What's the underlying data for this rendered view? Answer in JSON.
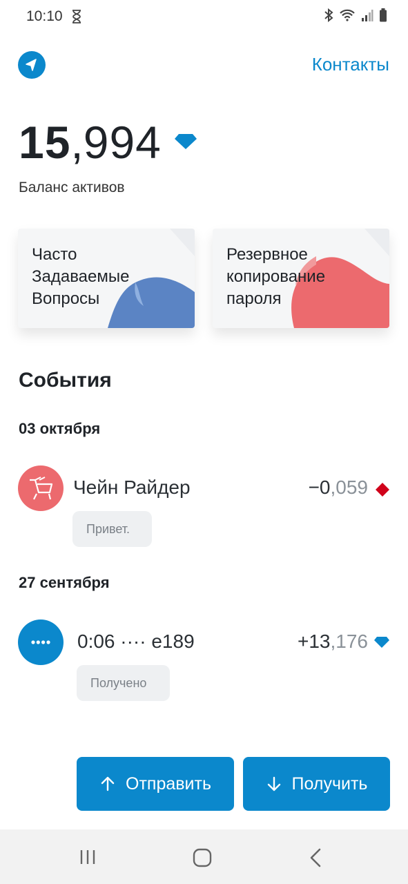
{
  "status_bar": {
    "time": "10:10",
    "icons": [
      "hourglass-icon",
      "bluetooth-icon",
      "wifi-icon",
      "signal-icon",
      "battery-icon"
    ]
  },
  "header": {
    "back_icon": "back-arrow-icon",
    "contacts_label": "Контакты"
  },
  "balance": {
    "integer_part": "15",
    "separator": ",",
    "fraction_part": "994",
    "label": "Баланс активов",
    "currency_icon": "diamond-icon"
  },
  "cards": [
    {
      "title": "Часто\nЗадаваемые\nВопросы",
      "color": "#5b84c4"
    },
    {
      "title": "Резервное\nкопирование\nпароля",
      "color": "#ec6a6e"
    }
  ],
  "events": {
    "title": "События",
    "groups": [
      {
        "date": "03 октября",
        "transactions": [
          {
            "name": "Чейн Райдер",
            "amount_main": "−0",
            "amount_sep": ",",
            "amount_frac": "059",
            "icon": "red-diamond-icon",
            "note": "Привет.",
            "avatar_color": "#ec6a6e",
            "avatar_icon": "cart-icon"
          }
        ]
      },
      {
        "date": "27 сентября",
        "transactions": [
          {
            "name": "0:06 ···· e189",
            "amount_main": "+13",
            "amount_sep": ",",
            "amount_frac": "176",
            "icon": "blue-diamond-icon",
            "note": "Получено",
            "avatar_color": "#0b88cc",
            "avatar_icon": "dots-icon"
          }
        ]
      }
    ]
  },
  "actions": {
    "send_label": "Отправить",
    "receive_label": "Получить"
  },
  "nav_bar": {
    "icons": [
      "recent-apps-icon",
      "home-icon",
      "back-icon"
    ]
  },
  "colors": {
    "accent": "#0b88cc",
    "negative": "#d0021b"
  }
}
